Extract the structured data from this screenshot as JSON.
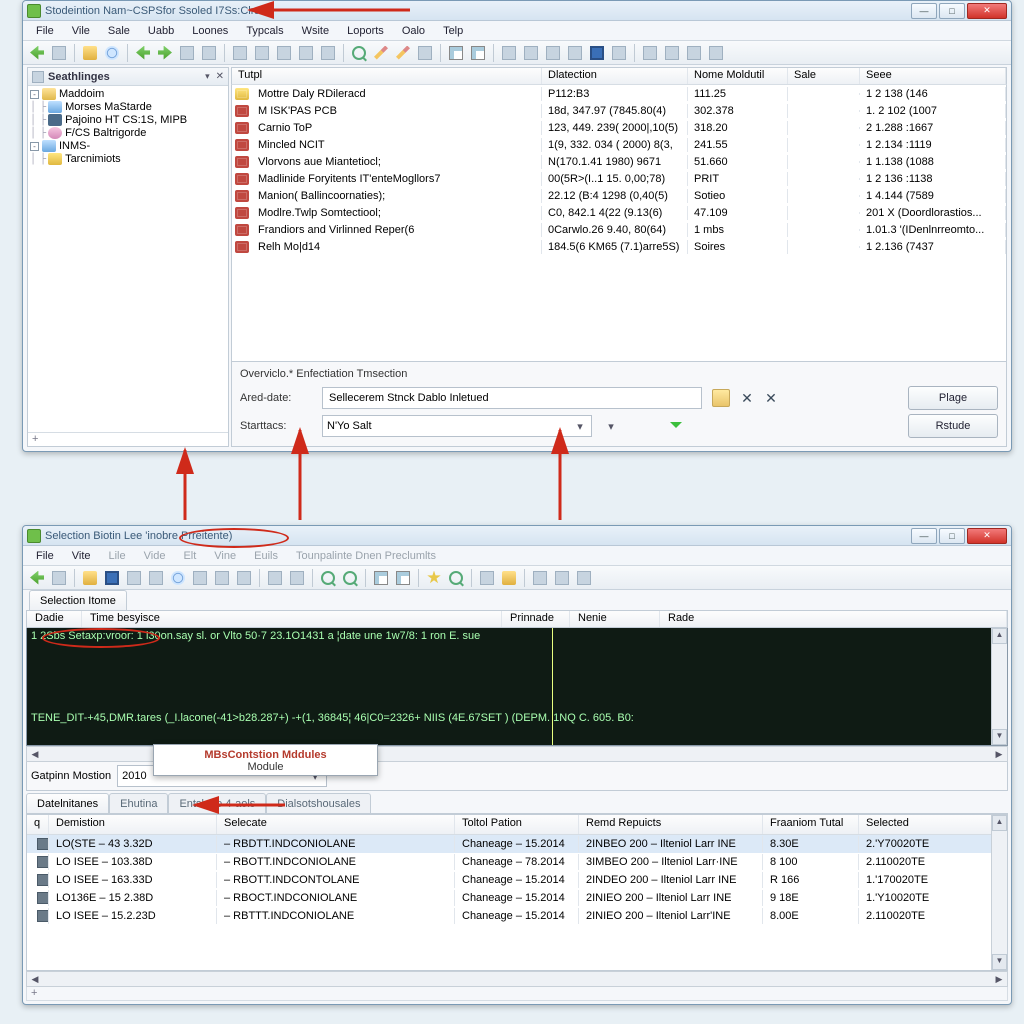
{
  "win1": {
    "title": "Stodeintion Nam~CSPSfor Ssoled I7Ss:Clrad",
    "menu": [
      "File",
      "Vile",
      "Sale",
      "Uabb",
      "Loones",
      "Typcals",
      "Wsite",
      "Loports",
      "Oalo",
      "Telp"
    ],
    "tree_header": "Seathlinges",
    "tree": [
      {
        "tg": "-",
        "ic": "nic-folder",
        "label": "Maddoim"
      },
      {
        "indent": 1,
        "ic": "nic-blue",
        "label": "Morses MaStarde"
      },
      {
        "indent": 1,
        "ic": "nic-dark",
        "label": "Pajoino HT CS:1S, MIPB"
      },
      {
        "indent": 1,
        "ic": "nic-pink",
        "label": "F/CS Baltrigorde"
      },
      {
        "tg": "-",
        "ic": "nic-blue",
        "label": "INMS-"
      },
      {
        "indent": 1,
        "ic": "nic-yell",
        "label": "Tarcnimiots"
      }
    ],
    "cols": [
      "Tutpl",
      "Dlatection",
      "Nome Moldutil",
      "Sale",
      "Seee"
    ],
    "rows": [
      {
        "ic": "y",
        "c": [
          "Mottre Daly RDileracd",
          "P112:B3",
          "111.25",
          "",
          "1 2 138  (146"
        ]
      },
      {
        "c": [
          "M ISK'PAS PCB",
          "18d, 347.97 (7845.80(4)",
          "302.378",
          "",
          "1. 2 102  (1007"
        ]
      },
      {
        "c": [
          "Carnio ToP",
          "123, 449. 239( 2000|,10(5)",
          "318.20",
          "",
          "2 1.288  :1667"
        ]
      },
      {
        "c": [
          "Mincled NCIT",
          "1(9, 332. 034 ( 2000) 8(3,",
          "241.55",
          "",
          "1 2.134  :1119"
        ]
      },
      {
        "c": [
          "Vlorvons aue Miantetiocl;",
          "N(170.1.41 1980) 9671",
          "51.660",
          "",
          "1 1.138  (1088"
        ]
      },
      {
        "c": [
          "Madlinide Foryitents IT'enteMogllors7",
          "00(5R>(I..1 15. 0,00;78)",
          "PRIT",
          "",
          "1 2 136 :1138"
        ]
      },
      {
        "c": [
          "Manion( Ballincoornaties);",
          "22.12 (B:4 1298 (0,40(5)",
          "Sotieo",
          "",
          "1 4.144  (7589"
        ]
      },
      {
        "c": [
          "Modlre.Twlp Somtectiool;",
          "C0, 842.1 4(22 (9.13(6)",
          "47.109",
          "",
          "201 X (Doordlorastios..."
        ]
      },
      {
        "c": [
          "Frandiors and Virlinned Reper(6",
          "0Carwlo.26 9.40, 80(64)",
          "1 mbs",
          "",
          "1.01.3 '(IDenlnrreomto..."
        ]
      },
      {
        "c": [
          "Relh Mo|d14",
          "184.5(6 KM65 (7.1)arre5S)",
          "Soires",
          "",
          "1 2.136  (7437"
        ]
      }
    ],
    "overview_title": "Overviclo.* Enfectiation Tmsection",
    "fields": {
      "ared_label": "Ared-date:",
      "ared_value": "Sellecerem Stnck Dablo Inletued",
      "start_label": "Starttacs:",
      "start_value": "N'Yo Salt"
    },
    "buttons": {
      "plage": "Plage",
      "retude": "Rstude"
    }
  },
  "win2": {
    "title": "Selection Biotin Lee 'inobre Prreitente)",
    "menu": [
      "File",
      "Vite",
      "Lile",
      "Vide",
      "Elt",
      "Vine",
      "Euils",
      "Tounpalinte Dnen Preclumlts"
    ],
    "tab1": "Selection Itome",
    "cols": [
      "Dadie",
      "Time besyisce",
      "Prinnade",
      "Nenie",
      "Rade"
    ],
    "dark_row1": "1  2Sbs Setaxp:vroor:  1 i30on.say sl. or Vlto  50·7 23.1O1431 a    ¦date une     1w7/8: 1  ron                         E. sue",
    "dark_row2": "TENE_DIT-+45,DMR.tares   (_I.lacone(-41>b28.287+) -+(1, 36845¦ 46|C0=2326+        NIIS (4E.67SET )                 (DEPM. 1NQ C. 605. B0:",
    "popup": {
      "t": "MBsContstion Mddules",
      "s": "Module"
    },
    "sel_label": "Gatpinn Mostion",
    "sel_value": "2010",
    "tabs2": [
      "Datelnitanes",
      "Ehutina",
      "Entslnge 4-aols",
      "Dialsotshousales"
    ],
    "gcols": [
      "q",
      "Demistion",
      "Selecate",
      "Toltol Pation",
      "Remd Repuicts",
      "Fraaniom Tutal",
      "Selected"
    ],
    "grows": [
      {
        "sel": true,
        "c": [
          "",
          "LO(STE – 43 3.32D",
          "– RBDTT.INDCONIOLANE",
          "Chaneage – 15.2014",
          "2INBEO 200 – Ilteniol Larr INE",
          "8.30E",
          "2.'Y70020TE"
        ]
      },
      {
        "c": [
          "",
          "LO ISEE – 103.38D",
          "– RBOTT.INDCONIOLANE",
          "Chaneage – 78.2014",
          "3IMBEO 200 – Ilteniol Larr·INE",
          "8 100",
          "2.110020TE"
        ]
      },
      {
        "c": [
          "",
          "LO ISEE – 163.33D",
          "– RBOTT.INDCONTOLANE",
          "Chaneage – 15.2014",
          "2INDEO 200 – Ilteniol Larr INE",
          "R 166",
          "1.'170020TE"
        ]
      },
      {
        "c": [
          "",
          "LO136E – 15 2.38D",
          "– RBOCT.INDCONIOLANE",
          "Chaneage – 15.2014",
          "2INIEO 200 – Ilteniol Larr INE",
          "9 18E",
          "1.'Y10020TE"
        ]
      },
      {
        "c": [
          "",
          "LO ISEE – 15.2.23D",
          "– RBTTT.INDCONIOLANE",
          "Chaneage – 15.2014",
          "2INIEO 200 – Ilteniol Larr'INE",
          "8.00E",
          "2.110020TE"
        ]
      }
    ]
  }
}
